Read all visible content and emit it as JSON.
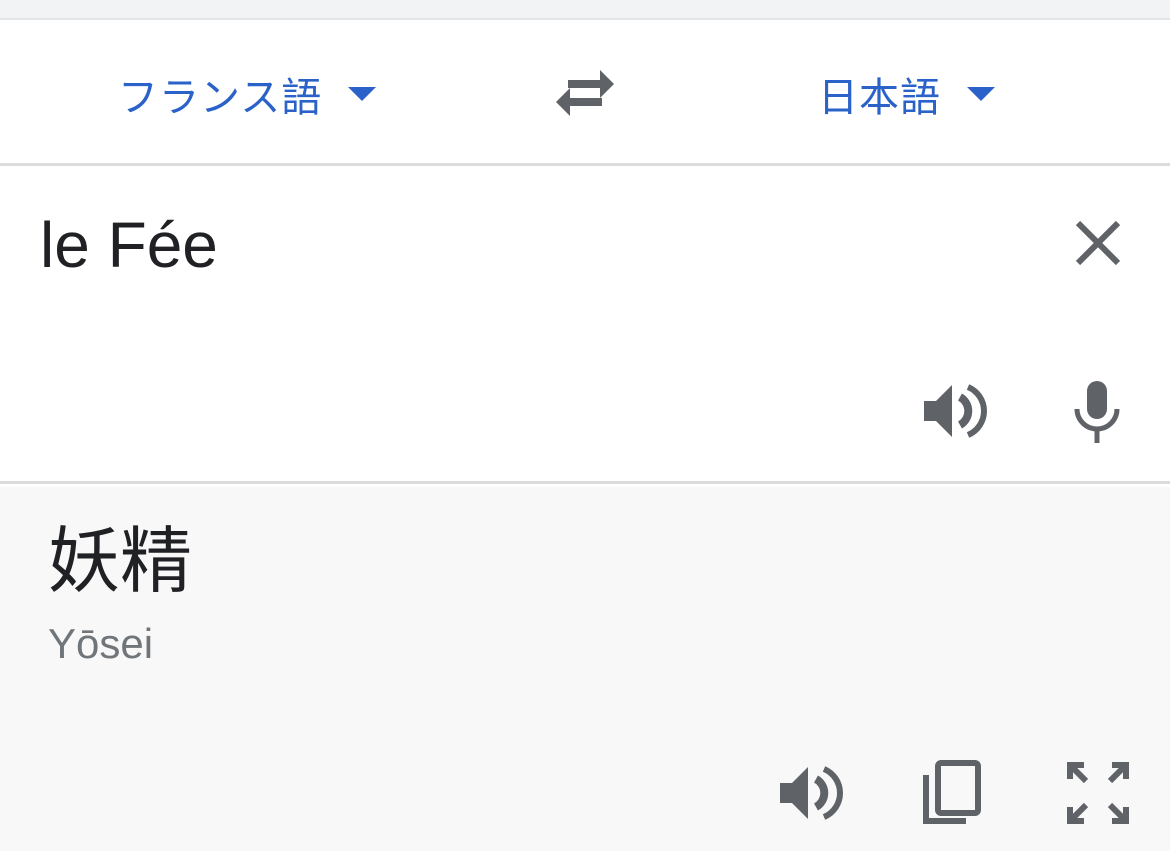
{
  "languages": {
    "source": "フランス語",
    "target": "日本語"
  },
  "input": {
    "text": "le Fée"
  },
  "output": {
    "translation": "妖精",
    "romanization": "Yōsei"
  },
  "icons": {
    "caret": "triangle-down-icon",
    "swap": "swap-arrows-icon",
    "clear": "close-icon",
    "speaker": "speaker-icon",
    "mic": "microphone-icon",
    "copy": "copy-icon",
    "fullscreen": "fullscreen-icon"
  },
  "colors": {
    "accent": "#2a62c9",
    "icon": "#5f6368",
    "output_background": "#f8f8f8"
  }
}
